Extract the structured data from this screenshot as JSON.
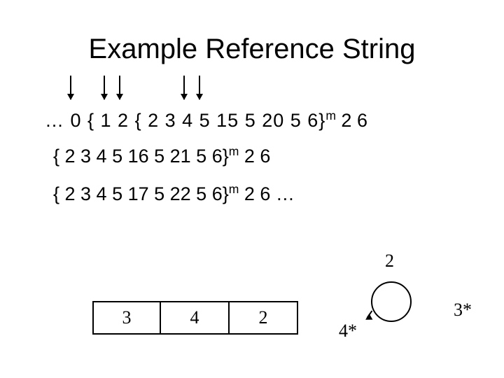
{
  "title": "Example Reference String",
  "lines": {
    "l1_a": "… 0 { 1  2  { 2  3  4  5  15  5  20  5  6}",
    "l1_b": " 2  6",
    "l2_a": "{ 2  3  4  5  16  5  21  5  6}",
    "l2_b": " 2  6",
    "l3_a": "{ 2  3  4  5  17  5  22  5  6}",
    "l3_b": " 2  6 ",
    "l3_c": "…",
    "sup": "m"
  },
  "over_circle": "2",
  "frames": [
    "3",
    "4",
    "2"
  ],
  "outside": {
    "left": "4*",
    "right": "3*"
  }
}
